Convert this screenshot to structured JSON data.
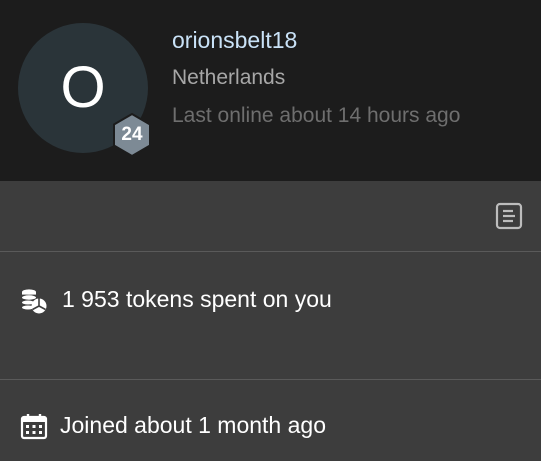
{
  "profile": {
    "avatar_initial": "O",
    "level": "24",
    "username": "orionsbelt18",
    "country": "Netherlands",
    "last_online": "Last online about 14 hours ago"
  },
  "toolbar": {
    "notes_icon": "notes-icon"
  },
  "stats": {
    "tokens_icon": "coins-pie-icon",
    "tokens_text": "1 953 tokens spent on you",
    "joined_icon": "calendar-icon",
    "joined_text": "Joined about 1 month ago"
  },
  "colors": {
    "header_bg": "#1c1c1c",
    "body_bg": "#3d3d3d",
    "username": "#c9e2f7",
    "avatar_bg": "#2a3439",
    "badge": "#7d8a95"
  }
}
